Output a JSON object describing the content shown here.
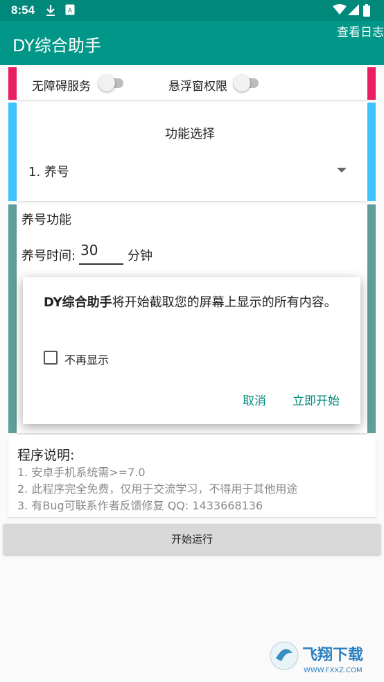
{
  "status_bar": {
    "time": "8:54"
  },
  "app_bar": {
    "title": "DY综合助手",
    "log_button": "查看日志"
  },
  "permissions": {
    "accessibility_label": "无障碍服务",
    "overlay_label": "悬浮窗权限"
  },
  "function_select": {
    "title": "功能选择",
    "selected": "1. 养号"
  },
  "feature": {
    "title": "养号功能",
    "time_label": "养号时间:",
    "time_value": "30",
    "time_unit": "分钟"
  },
  "dialog": {
    "app_name": "DY综合助手",
    "message": "将开始截取您的屏幕上显示的所有内容。",
    "checkbox_label": "不再显示",
    "cancel": "取消",
    "confirm": "立即开始"
  },
  "info": {
    "title": "程序说明:",
    "lines": [
      "1. 安卓手机系统需>=7.0",
      "2. 此程序完全免费，仅用于交流学习，不得用于其他用途",
      "3. 有Bug可联系作者反馈修复 QQ: 1433668136"
    ]
  },
  "start_button": "开始运行",
  "watermark": "飞翔下载",
  "watermark_url": "WWW.FXXZ.COM",
  "colors": {
    "primary": "#009688",
    "status_bar": "#00897b",
    "pink": "#e91e63",
    "blue": "#40c4ff",
    "teal_gray": "#5f9e9a"
  },
  "icons": [
    "download-icon",
    "sim-icon",
    "wifi-icon",
    "signal-icon",
    "battery-icon",
    "dropdown-arrow-icon"
  ]
}
